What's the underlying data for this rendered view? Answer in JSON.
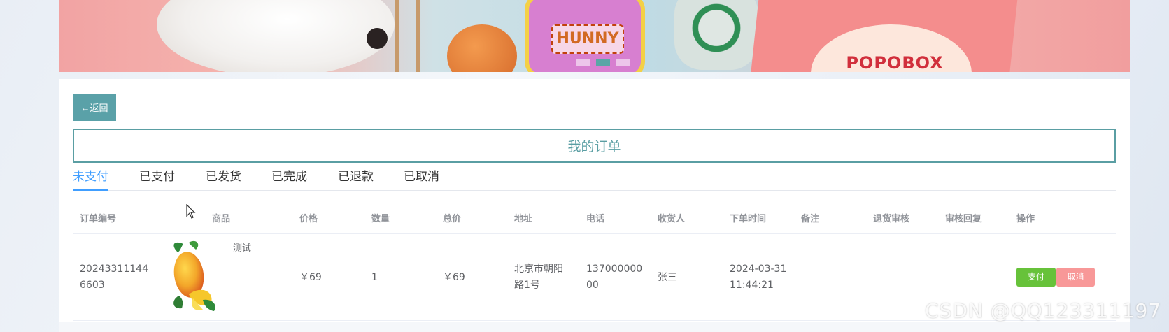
{
  "banner": {
    "slide_count": 3,
    "active_slide": 2,
    "toy_label": "HUNNY",
    "box_label": "POPOBOX"
  },
  "nav": {
    "back_label": "←返回"
  },
  "page_title": "我的订单",
  "tabs": [
    {
      "label": "未支付",
      "active": true
    },
    {
      "label": "已支付"
    },
    {
      "label": "已发货"
    },
    {
      "label": "已完成"
    },
    {
      "label": "已退款"
    },
    {
      "label": "已取消"
    }
  ],
  "table": {
    "columns": [
      "订单编号",
      "商品",
      "价格",
      "数量",
      "总价",
      "地址",
      "电话",
      "收货人",
      "下单时间",
      "备注",
      "退货审核",
      "审核回复",
      "操作"
    ],
    "rows": [
      {
        "order_no_line1": "20243311144",
        "order_no_line2": "6603",
        "product_name": "测试",
        "product_image": "mango-image",
        "price": "￥69",
        "quantity": "1",
        "total": "￥69",
        "address_line1": "北京市朝阳",
        "address_line2": "路1号",
        "phone_line1": "137000000",
        "phone_line2": "00",
        "receiver": "张三",
        "time_line1": "2024-03-31",
        "time_line2": "11:44:21",
        "remark": "",
        "return_review": "",
        "review_reply": "",
        "pay_label": "支付",
        "cancel_label": "取消"
      }
    ]
  },
  "watermark": "CSDN @QQ123311197",
  "colors": {
    "accent": "#5aa1a8",
    "tab_active": "#409eff",
    "pay": "#67c23a",
    "cancel": "#f89898"
  }
}
